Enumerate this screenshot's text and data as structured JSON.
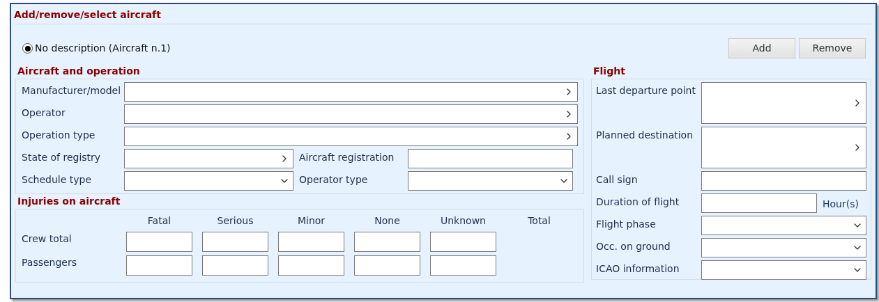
{
  "section_title": "Add/remove/select aircraft",
  "aircraft_list": [
    {
      "label": "No description (Aircraft n.1)",
      "selected": true
    }
  ],
  "buttons": [
    "Add",
    "Remove"
  ],
  "aircraft_and_operation": {
    "title": "Aircraft and operation",
    "rows": [
      {
        "fields": [
          {
            "label": "Manufacturer/model",
            "kind": "lookup"
          }
        ]
      },
      {
        "fields": [
          {
            "label": "Operator",
            "kind": "lookup"
          }
        ]
      },
      {
        "fields": [
          {
            "label": "Operation type",
            "kind": "lookup"
          }
        ]
      },
      {
        "fields": [
          {
            "label": "State of registry",
            "kind": "lookup"
          },
          {
            "label": "Aircraft registration",
            "kind": "text"
          }
        ]
      },
      {
        "fields": [
          {
            "label": "Schedule type",
            "kind": "select"
          },
          {
            "label": "Operator type",
            "kind": "select"
          }
        ]
      }
    ]
  },
  "injuries": {
    "title": "Injuries on aircraft",
    "columns": [
      {
        "label": "Fatal",
        "kind": "input"
      },
      {
        "label": "Serious",
        "kind": "input"
      },
      {
        "label": "Minor",
        "kind": "input"
      },
      {
        "label": "None",
        "kind": "input"
      },
      {
        "label": "Unknown",
        "kind": "input"
      },
      {
        "label": "Total",
        "kind": "computed"
      }
    ],
    "rows": [
      "Crew total",
      "Passengers"
    ]
  },
  "flight": {
    "title": "Flight",
    "fields": [
      {
        "label": "Last departure point",
        "kind": "lookup_tall"
      },
      {
        "label": "Planned destination",
        "kind": "lookup_tall"
      },
      {
        "label": "Call sign",
        "kind": "text"
      },
      {
        "label": "Duration of flight",
        "kind": "text",
        "unit": "Hour(s)"
      },
      {
        "label": "Flight phase",
        "kind": "select"
      },
      {
        "label": "Occ. on ground",
        "kind": "select"
      },
      {
        "label": "ICAO information",
        "kind": "select"
      }
    ]
  }
}
